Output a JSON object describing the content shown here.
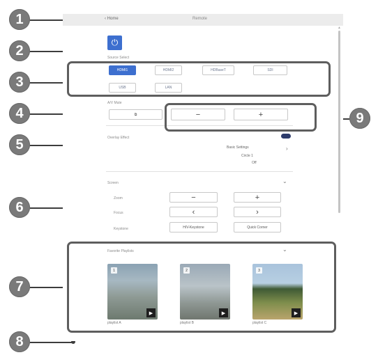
{
  "callouts": [
    "1",
    "2",
    "3",
    "4",
    "5",
    "6",
    "7",
    "8",
    "9"
  ],
  "header": {
    "back_label": "Home",
    "title": "Remote"
  },
  "source_select": {
    "label": "Source Select",
    "buttons": [
      "HDMI1",
      "HDMI2",
      "HDBaseT",
      "SDI",
      "USB",
      "LAN"
    ],
    "active": "HDMI1"
  },
  "av_mute": {
    "label": "A/V Mute",
    "icon": "av-mute-icon"
  },
  "volume": {
    "minus": "−",
    "plus": "+"
  },
  "overlay_effect": {
    "label": "Overlay Effect",
    "toggle_state": "on",
    "basic_settings": "Basic Settings",
    "circle": "Circle 1",
    "state": "Off"
  },
  "screen": {
    "label": "Screen",
    "zoom_label": "Zoom",
    "zoom_minus": "−",
    "zoom_plus": "+",
    "focus_label": "Focus",
    "focus_left": "‹",
    "focus_right": "›",
    "keystone_label": "Keystone",
    "hv_keystone": "H/V-Keystone",
    "quick_corner": "Quick Corner"
  },
  "favorites": {
    "label": "Favorite Playlists",
    "items": [
      {
        "number": "1",
        "caption": "playlist A"
      },
      {
        "number": "2",
        "caption": "playlist B"
      },
      {
        "number": "3",
        "caption": "playlist C"
      }
    ]
  },
  "colors": {
    "accent": "#3d6fcf",
    "callout": "#7a7a7a",
    "frame": "#5e5e5e"
  }
}
